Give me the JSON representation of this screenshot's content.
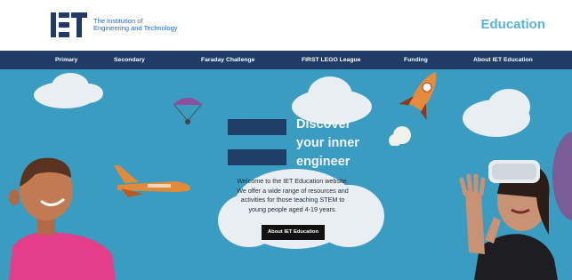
{
  "header": {
    "logo_mark": "IET",
    "logo_line1": "The Institution of",
    "logo_line2": "Engineering and Technology",
    "brand": "Education"
  },
  "nav": {
    "items": [
      {
        "label": "Primary"
      },
      {
        "label": "Secondary"
      },
      {
        "label": "Faraday Challenge"
      },
      {
        "label": "FIRST LEGO League"
      },
      {
        "label": "Funding"
      },
      {
        "label": "About IET Education"
      }
    ]
  },
  "hero": {
    "title_line1": "Discover",
    "title_line2": "your inner",
    "title_line3": "engineer",
    "welcome_line1": "Welcome to the IET Education website.",
    "welcome_line2": "We offer a wide range of resources and",
    "welcome_line3": "activities for those teaching STEM to",
    "welcome_line4": "young people aged 4-19 years.",
    "cta_label": "About IET Education"
  },
  "colors": {
    "nav_bg": "#1f3b66",
    "hero_bg": "#3a9cc0",
    "brand": "#58b4da",
    "accent_box": "#1e3e66"
  },
  "icons": [
    "iet-logo-icon",
    "parachute-icon",
    "rocket-icon",
    "space-shuttle-icon",
    "planet-icon"
  ]
}
